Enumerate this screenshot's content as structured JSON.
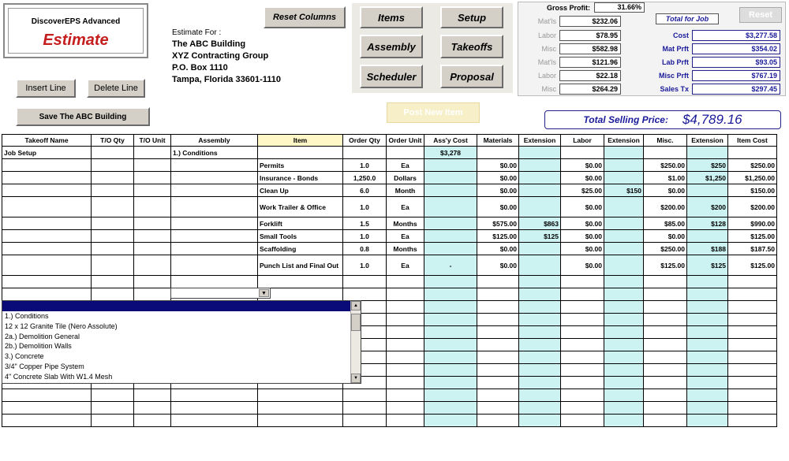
{
  "app": {
    "line1": "DiscoverEPS Advanced",
    "line2": "Estimate"
  },
  "buttons": {
    "reset_columns": "Reset Columns",
    "insert_line": "Insert Line",
    "delete_line": "Delete Line",
    "save": "Save The ABC Building",
    "items": "Items",
    "setup": "Setup",
    "assembly": "Assembly",
    "takeoffs": "Takeoffs",
    "scheduler": "Scheduler",
    "proposal": "Proposal",
    "post_new_item": "Post New Item",
    "reset_small": "Reset"
  },
  "estimate_for": {
    "label": "Estimate For :",
    "name": "The ABC Building",
    "company": "XYZ Contracting Group",
    "address1": "P.O. Box 1110",
    "address2": "Tampa, Florida 33601-1110"
  },
  "financials": {
    "gross_profit_label": "Gross Profit:",
    "gross_profit_value": "31.66%",
    "total_for_job": "Total for Job",
    "left": [
      {
        "label": "Mat'ls",
        "value": "$232.06"
      },
      {
        "label": "Labor",
        "value": "$78.95"
      },
      {
        "label": "Misc",
        "value": "$582.98"
      },
      {
        "label": "Mat'ls",
        "value": "$121.96"
      },
      {
        "label": "Labor",
        "value": "$22.18"
      },
      {
        "label": "Misc",
        "value": "$264.29"
      }
    ],
    "right": [
      {
        "label": "Cost",
        "value": "$3,277.58"
      },
      {
        "label": "Mat Prft",
        "value": "$354.02"
      },
      {
        "label": "Lab Prft",
        "value": "$93.05"
      },
      {
        "label": "Misc Prft",
        "value": "$767.19"
      },
      {
        "label": "Sales Tx",
        "value": "$297.45"
      }
    ],
    "total_selling_label": "Total Selling Price:",
    "total_selling_value": "$4,789.16"
  },
  "table": {
    "headers": [
      "Takeoff Name",
      "T/O Qty",
      "T/O Unit",
      "Assembly",
      "Item",
      "Order Qty",
      "Order Unit",
      "Ass'y Cost",
      "Materials",
      "Extension",
      "Labor",
      "Extension",
      "Misc.",
      "Extension",
      "Item Cost"
    ],
    "rows": [
      [
        "Job Setup",
        "",
        "",
        "1.) Conditions",
        "",
        "",
        "",
        "$3,278",
        "",
        "",
        "",
        "",
        "",
        "",
        ""
      ],
      [
        "",
        "",
        "",
        "",
        "Permits",
        "1.0",
        "Ea",
        "",
        "$0.00",
        "",
        "$0.00",
        "",
        "$250.00",
        "$250",
        "$250.00"
      ],
      [
        "",
        "",
        "",
        "",
        "Insurance - Bonds",
        "1,250.0",
        "Dollars",
        "",
        "$0.00",
        "",
        "$0.00",
        "",
        "$1.00",
        "$1,250",
        "$1,250.00"
      ],
      [
        "",
        "",
        "",
        "",
        "Clean Up",
        "6.0",
        "Month",
        "",
        "$0.00",
        "",
        "$25.00",
        "$150",
        "$0.00",
        "",
        "$150.00"
      ],
      [
        "",
        "",
        "",
        "",
        "Work Trailer & Office",
        "1.0",
        "Ea",
        "",
        "$0.00",
        "",
        "$0.00",
        "",
        "$200.00",
        "$200",
        "$200.00"
      ],
      [
        "",
        "",
        "",
        "",
        "Forklift",
        "1.5",
        "Months",
        "",
        "$575.00",
        "$863",
        "$0.00",
        "",
        "$85.00",
        "$128",
        "$990.00"
      ],
      [
        "",
        "",
        "",
        "",
        "Small Tools",
        "1.0",
        "Ea",
        "",
        "$125.00",
        "$125",
        "$0.00",
        "",
        "$0.00",
        "",
        "$125.00"
      ],
      [
        "",
        "",
        "",
        "",
        "Scaffolding",
        "0.8",
        "Months",
        "",
        "$0.00",
        "",
        "$0.00",
        "",
        "$250.00",
        "$188",
        "$187.50"
      ],
      [
        "",
        "",
        "",
        "",
        "Punch List and Final Out",
        "1.0",
        "Ea",
        "-",
        "$0.00",
        "",
        "$0.00",
        "",
        "$125.00",
        "$125",
        "$125.00"
      ]
    ]
  },
  "assembly_list": [
    "1.) Conditions",
    "12 x 12 Granite Tile (Nero Assolute)",
    "2a.) Demolition General",
    "2b.) Demolition Walls",
    "3.) Concrete",
    "3/4\" Copper Pipe System",
    "4\" Concrete Slab With W1.4 Mesh"
  ]
}
